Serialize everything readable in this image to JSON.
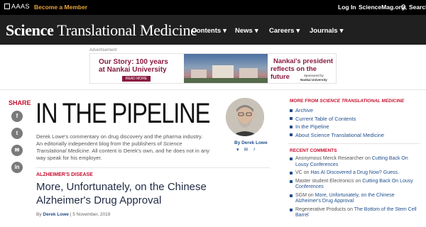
{
  "topbar": {
    "logo": "AAAS",
    "member_link": "Become a Member",
    "login": "Log In",
    "sciencemag": "ScienceMag.org",
    "search": "Search"
  },
  "masthead": {
    "journal_bold": "Science",
    "journal_rest": "Translational Medicine",
    "nav": [
      "Contents",
      "News",
      "Careers",
      "Journals"
    ]
  },
  "ad": {
    "label": "Advertisement",
    "left_line1": "Our Story: 100 years",
    "left_line2": "at Nankai University",
    "read_more": "READ MORE",
    "right_line1": "Nankai's president",
    "right_line2": "reflects on the future",
    "sponsor_line1": "Sponsored by",
    "sponsor_line2": "Nankai University"
  },
  "share": {
    "label": "SHARE",
    "buttons": [
      "f",
      "t",
      "✉",
      "in"
    ]
  },
  "blog": {
    "title": "IN THE PIPELINE",
    "desc_part1": "Derek Lowe's commentary on drug discovery and the pharma industry. An editorially independent blog from the publishers of ",
    "desc_italic": "Science Translational Medicine",
    "desc_part2": ". All content is Derek's own, and he does not in any way speak for his employer.",
    "author_by": "By Derek Lowe",
    "author_icons": [
      "▾",
      "✉",
      "♪"
    ]
  },
  "article": {
    "category": "ALZHEIMER'S DISEASE",
    "headline": "More, Unfortunately, on the Chinese Alzheimer's Drug Approval",
    "by_prefix": "By ",
    "author": "Derek Lowe",
    "sep": " | ",
    "date": "5 November, 2019"
  },
  "sidebar": {
    "more_prefix": "MORE FROM ",
    "more_journal": "SCIENCE TRANSLATIONAL MEDICINE",
    "links": [
      "Archive",
      "Current Table of Contents",
      "In the Pipeline",
      "About Science Translational Medicine"
    ],
    "recent_heading": "RECENT COMMENTS",
    "comments": [
      {
        "who": "Anonymous Merck Researcher",
        "on": "on",
        "post": "Cutting Back On Lousy Conferences"
      },
      {
        "who": "VC",
        "on": "on",
        "post": "Has AI Discovered a Drug Now? Guess."
      },
      {
        "who": "Master student Electronics",
        "on": "on",
        "post": "Cutting Back On Lousy Conferences"
      },
      {
        "who": "SGM",
        "on": "on",
        "post": "More, Unfortunately, on the Chinese Alzheimer's Drug Approval"
      },
      {
        "who": "Regenerative Products",
        "on": "on",
        "post": "The Bottom of the Stem Cell Barrel"
      }
    ]
  },
  "colors": {
    "accent_red": "#c8102e",
    "link_blue": "#1f4e8c",
    "member_orange": "#e8a23a",
    "header_dark": "#202020"
  }
}
